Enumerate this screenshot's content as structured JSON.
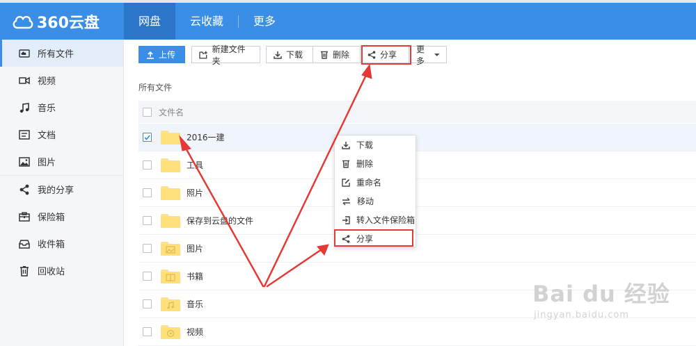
{
  "app": {
    "logo_text": "360云盘",
    "brand_color": "#3a8ee6",
    "accent_red": "#e53935"
  },
  "nav": {
    "tabs": [
      {
        "label": "网盘",
        "active": true
      },
      {
        "label": "云收藏"
      },
      {
        "label": "更多"
      }
    ]
  },
  "sidebar": {
    "items": [
      {
        "label": "所有文件",
        "icon": "cloud-icon",
        "active": true
      },
      {
        "label": "视频",
        "icon": "video-icon"
      },
      {
        "label": "音乐",
        "icon": "music-icon"
      },
      {
        "label": "文档",
        "icon": "document-icon"
      },
      {
        "label": "图片",
        "icon": "image-icon"
      },
      {
        "label": "我的分享",
        "icon": "share-icon"
      },
      {
        "label": "保险箱",
        "icon": "safe-icon"
      },
      {
        "label": "收件箱",
        "icon": "inbox-icon"
      },
      {
        "label": "回收站",
        "icon": "trash-icon"
      }
    ]
  },
  "toolbar": {
    "upload": "上传",
    "new_folder": "新建文件夹",
    "download": "下载",
    "delete": "删除",
    "share": "分享",
    "more": "更多"
  },
  "breadcrumb": "所有文件",
  "file_list": {
    "header": "文件名",
    "rows": [
      {
        "name": "2016一建",
        "checked": true,
        "icon": "folder-icon"
      },
      {
        "name": "工具",
        "checked": false,
        "icon": "folder-icon"
      },
      {
        "name": "照片",
        "checked": false,
        "icon": "folder-icon"
      },
      {
        "name": "保存到云盘的文件",
        "checked": false,
        "icon": "folder-icon"
      },
      {
        "name": "图片",
        "checked": false,
        "icon": "image-folder-icon"
      },
      {
        "name": "书籍",
        "checked": false,
        "icon": "book-folder-icon"
      },
      {
        "name": "音乐",
        "checked": false,
        "icon": "music-folder-icon"
      },
      {
        "name": "视频",
        "checked": false,
        "icon": "video-folder-icon"
      }
    ]
  },
  "context_menu": {
    "items": [
      "下载",
      "删除",
      "重命名",
      "移动",
      "转入文件保险箱",
      "分享"
    ]
  },
  "watermark": {
    "text": "Bai du 经验",
    "url": "jingyan.baidu.com"
  }
}
